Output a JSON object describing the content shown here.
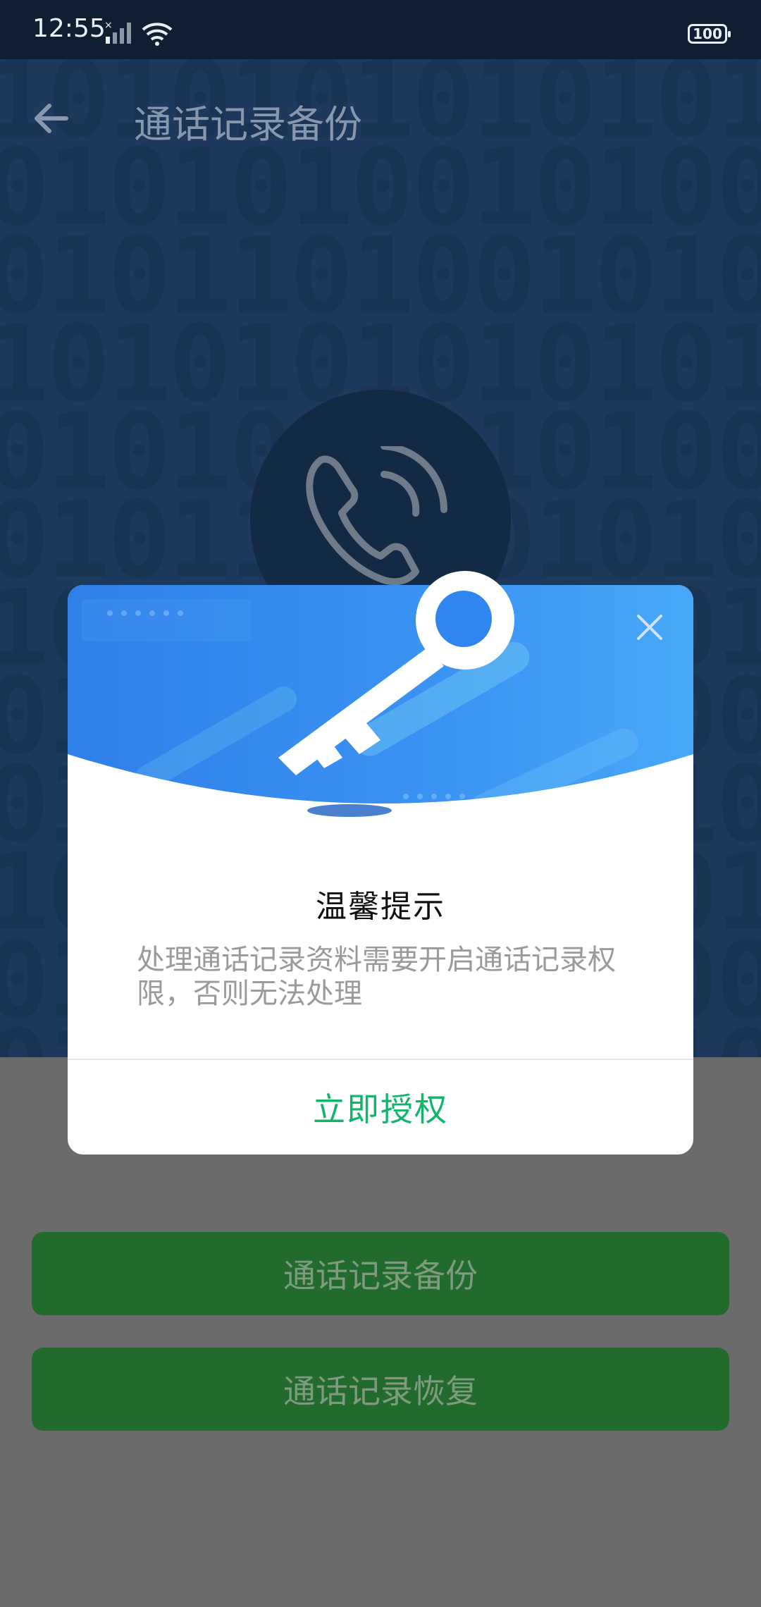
{
  "status_bar": {
    "time": "12:55",
    "battery": "100"
  },
  "app_bar": {
    "title": "通话记录备份",
    "back_icon": "back-arrow-icon"
  },
  "background": {
    "binary_pattern": "10101010101010\n01010100101001\n01011010010100\n10101010101010\n01010100101001\n01011010010100\n10101010101010\n01010100101001\n01011010010100\n10101010101010\n01010100101001\n01011010010100"
  },
  "center_icon": "phone-call-icon",
  "buttons": {
    "backup": "通话记录备份",
    "restore": "通话记录恢复"
  },
  "dialog": {
    "title": "温馨提示",
    "message": "处理通话记录资料需要开启通话记录权限，否则无法处理",
    "action": "立即授权",
    "close_icon": "close-icon",
    "header_icon": "key-icon"
  },
  "colors": {
    "hero_background": "#1d3a5c",
    "dialog_header": "#3a94f2",
    "action_text": "#13b36a",
    "button_green": "#236b2c"
  }
}
